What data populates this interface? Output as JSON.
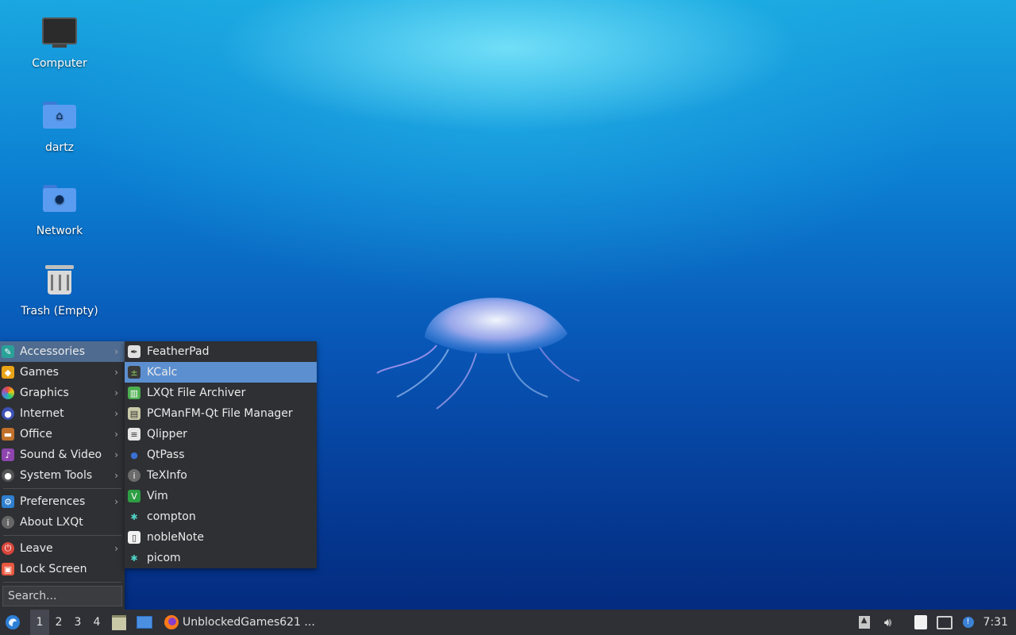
{
  "desktop": {
    "icons": [
      {
        "label": "Computer",
        "icon": "computer-icon"
      },
      {
        "label": "dartz",
        "icon": "home-folder-icon"
      },
      {
        "label": "Network",
        "icon": "network-folder-icon"
      },
      {
        "label": "Trash (Empty)",
        "icon": "trash-icon"
      }
    ]
  },
  "main_menu": {
    "items": [
      {
        "label": "Accessories",
        "icon": "accessories-icon",
        "submenu": true,
        "active": true
      },
      {
        "label": "Games",
        "icon": "games-icon",
        "submenu": true
      },
      {
        "label": "Graphics",
        "icon": "graphics-icon",
        "submenu": true
      },
      {
        "label": "Internet",
        "icon": "internet-icon",
        "submenu": true
      },
      {
        "label": "Office",
        "icon": "office-icon",
        "submenu": true
      },
      {
        "label": "Sound & Video",
        "icon": "sound-video-icon",
        "submenu": true
      },
      {
        "label": "System Tools",
        "icon": "system-tools-icon",
        "submenu": true
      },
      {
        "label": "Preferences",
        "icon": "preferences-icon",
        "submenu": true
      },
      {
        "label": "About LXQt",
        "icon": "info-icon",
        "submenu": false
      },
      {
        "label": "Leave",
        "icon": "power-icon",
        "submenu": true
      },
      {
        "label": "Lock Screen",
        "icon": "lock-icon",
        "submenu": false
      }
    ],
    "search_placeholder": "Search..."
  },
  "sub_menu": {
    "items": [
      {
        "label": "FeatherPad",
        "icon": "featherpad-icon"
      },
      {
        "label": "KCalc",
        "icon": "kcalc-icon",
        "highlighted": true
      },
      {
        "label": "LXQt File Archiver",
        "icon": "archiver-icon"
      },
      {
        "label": "PCManFM-Qt File Manager",
        "icon": "file-manager-icon"
      },
      {
        "label": "Qlipper",
        "icon": "qlipper-icon"
      },
      {
        "label": "QtPass",
        "icon": "qtpass-icon"
      },
      {
        "label": "TeXInfo",
        "icon": "texinfo-icon"
      },
      {
        "label": "Vim",
        "icon": "vim-icon"
      },
      {
        "label": "compton",
        "icon": "compton-icon"
      },
      {
        "label": "nobleNote",
        "icon": "noblenote-icon"
      },
      {
        "label": "picom",
        "icon": "picom-icon"
      }
    ]
  },
  "taskbar": {
    "desktops": [
      "1",
      "2",
      "3",
      "4"
    ],
    "current_desktop": "1",
    "window_title": "UnblockedGames621 ...",
    "clock": "7:31"
  },
  "colors": {
    "menu_bg": "#2e3033",
    "highlight": "#5c8fd0",
    "active_category": "#4f6b8f",
    "taskbar_bg": "#2e3035"
  }
}
